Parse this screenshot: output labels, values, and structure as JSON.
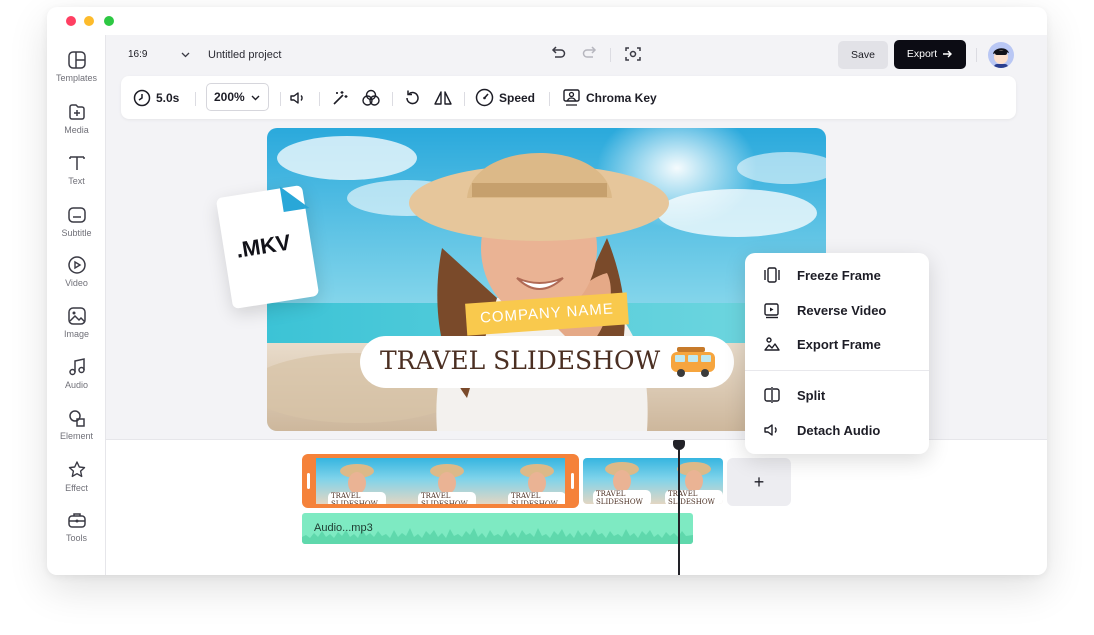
{
  "window": {
    "dots": [
      "#ff3f62",
      "#fdbb2b",
      "#2dc843"
    ]
  },
  "sidebar": {
    "items": [
      {
        "label": "Templates",
        "icon": "templates-icon"
      },
      {
        "label": "Media",
        "icon": "media-icon"
      },
      {
        "label": "Text",
        "icon": "text-icon"
      },
      {
        "label": "Subtitle",
        "icon": "subtitle-icon"
      },
      {
        "label": "Video",
        "icon": "video-icon"
      },
      {
        "label": "Image",
        "icon": "image-icon"
      },
      {
        "label": "Audio",
        "icon": "audio-icon"
      },
      {
        "label": "Element",
        "icon": "element-icon"
      },
      {
        "label": "Effect",
        "icon": "effect-icon"
      },
      {
        "label": "Tools",
        "icon": "tools-icon"
      }
    ]
  },
  "topbar": {
    "aspect_ratio": "16:9",
    "project_name": "Untitled project",
    "save_label": "Save",
    "export_label": "Export"
  },
  "toolbar": {
    "duration": "5.0s",
    "zoom": "200%",
    "speed_label": "Speed",
    "chroma_label": "Chroma Key"
  },
  "preview": {
    "company_name": "COMPANY NAME",
    "headline": "TRAVEL SLIDESHOW"
  },
  "file_badge": {
    "label": ".MKV"
  },
  "context_menu": {
    "items": [
      {
        "label": "Freeze Frame",
        "icon": "freeze-frame-icon"
      },
      {
        "label": "Reverse Video",
        "icon": "reverse-video-icon"
      },
      {
        "label": "Export Frame",
        "icon": "export-frame-icon"
      },
      {
        "label": "Split",
        "icon": "split-icon"
      },
      {
        "label": "Detach Audio",
        "icon": "detach-audio-icon"
      }
    ]
  },
  "timeline": {
    "clip_title": "TRAVEL SLIDESHOW",
    "audio_label": "Audio...mp3",
    "add_label": "+"
  },
  "colors": {
    "accent_orange": "#f5823a",
    "audio_green": "#7eeac2",
    "export_dark": "#0c0c14",
    "tag_yellow": "#f9c94d"
  }
}
